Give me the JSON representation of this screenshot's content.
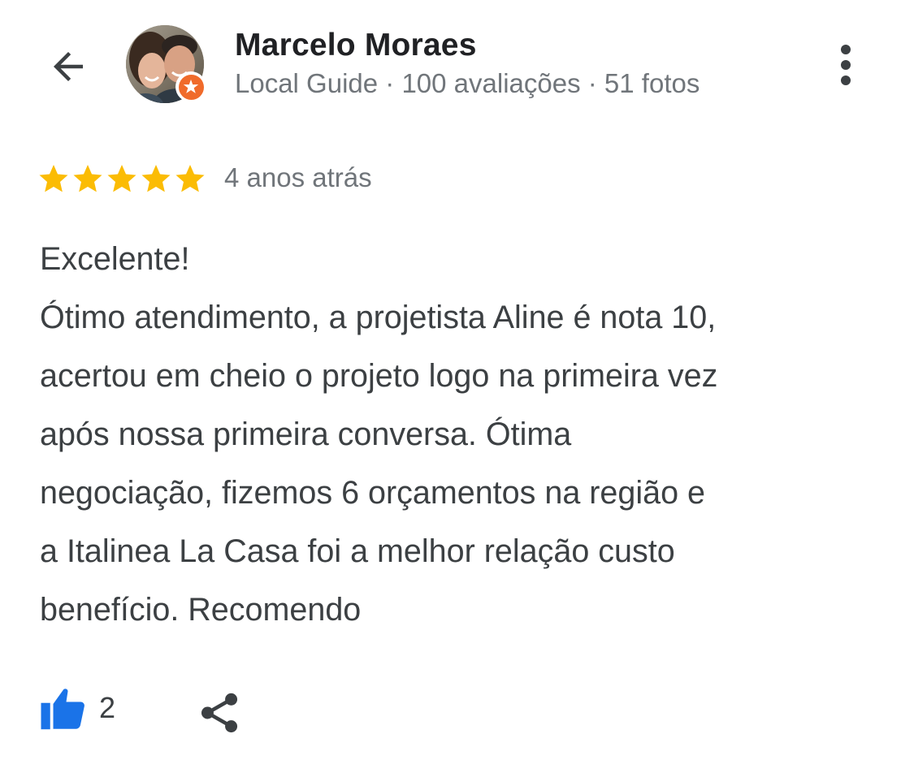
{
  "header": {
    "back_icon": "arrow-left-icon",
    "more_icon": "more-vert-icon"
  },
  "user": {
    "name": "Marcelo Moraes",
    "meta": "Local Guide · 100 avaliações · 51 fotos",
    "badge_icon": "local-guide-star-icon",
    "badge_color": "#f06b2b"
  },
  "review": {
    "rating": 5,
    "rating_max": 5,
    "star_color": "#fbbc04",
    "time": "4 anos atrás",
    "lines": [
      "Excelente!",
      "Ótimo atendimento, a projetista Aline é nota 10,",
      "acertou em cheio o projeto logo na primeira vez",
      "após nossa primeira conversa. Ótima",
      "negociação, fizemos 6 orçamentos na região e",
      "a Italinea La Casa foi a melhor relação custo",
      "benefício. Recomendo"
    ]
  },
  "actions": {
    "like_icon": "thumbs-up-icon",
    "like_color": "#1a73e8",
    "like_count": "2",
    "share_icon": "share-icon"
  }
}
